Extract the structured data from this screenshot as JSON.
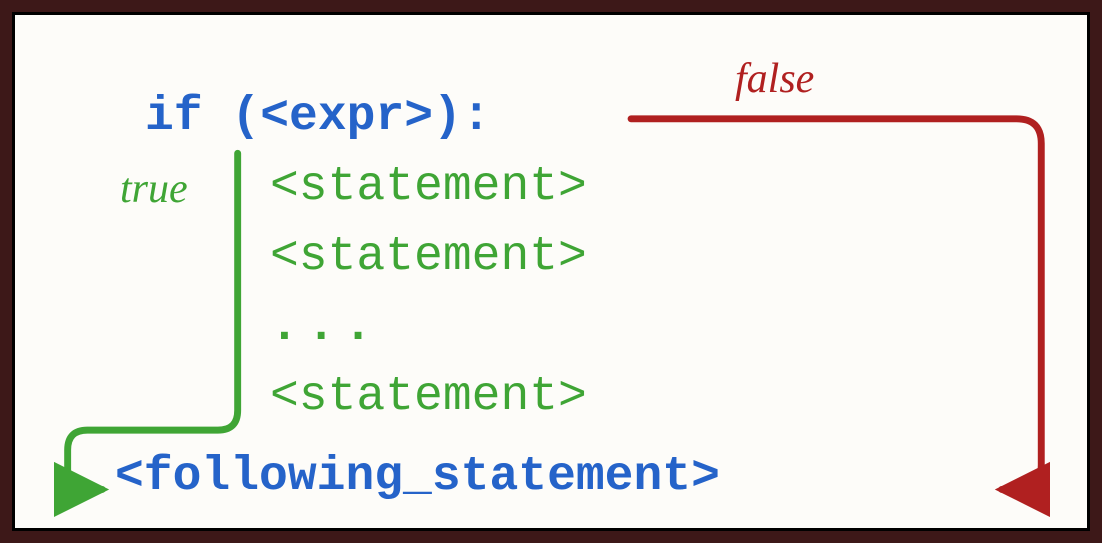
{
  "diagram": {
    "if_line": "if (<expr>):",
    "statement1": "<statement>",
    "statement2": "<statement>",
    "ellipsis": "...",
    "statement3": "<statement>",
    "following": "<following_statement>",
    "true_label": "true",
    "false_label": "false",
    "colors": {
      "keyword": "#2563c9",
      "true_path": "#3fa535",
      "false_path": "#b02020",
      "frame_bg": "#fdfcf9",
      "outer_bg": "#3d1818"
    }
  }
}
